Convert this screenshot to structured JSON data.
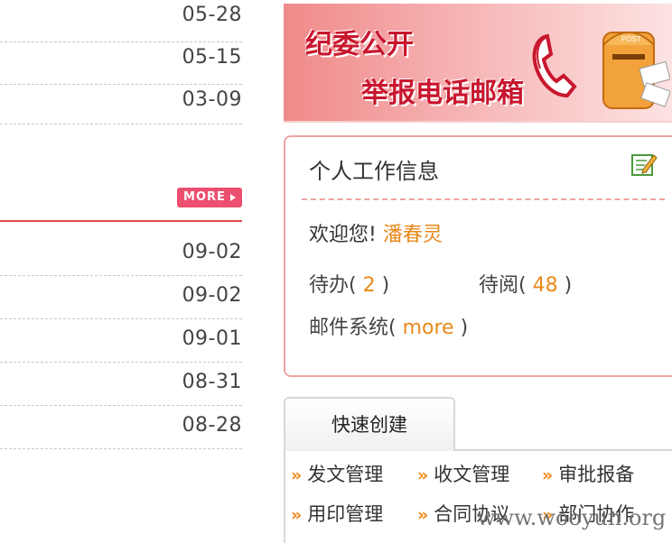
{
  "left_list_top": {
    "dates": [
      "05-28",
      "05-15",
      "03-09"
    ]
  },
  "more_badge": {
    "label": "MORE"
  },
  "left_list_bottom": {
    "dates": [
      "09-02",
      "09-02",
      "09-01",
      "08-31",
      "08-28"
    ]
  },
  "banner": {
    "line1": "纪委公开",
    "line2": "举报电话邮箱",
    "mailbox_text": "POST"
  },
  "info_panel": {
    "title": "个人工作信息",
    "welcome_prefix": "欢迎您!",
    "user_name": "潘春灵",
    "todo_label": "待办(",
    "todo_count": "2",
    "todo_close": ")",
    "toread_label": "待阅(",
    "toread_count": "48",
    "toread_close": ")",
    "mail_label": "邮件系统(",
    "mail_link": "more",
    "mail_close": ")"
  },
  "quick_create": {
    "tab_label": "快速创建",
    "items": [
      "发文管理",
      "收文管理",
      "审批报备",
      "用印管理",
      "合同协议",
      "部门协作"
    ]
  },
  "watermark": "www.wooyun.org",
  "colors": {
    "accent_orange": "#e8891a",
    "accent_red": "#e04a4a"
  }
}
